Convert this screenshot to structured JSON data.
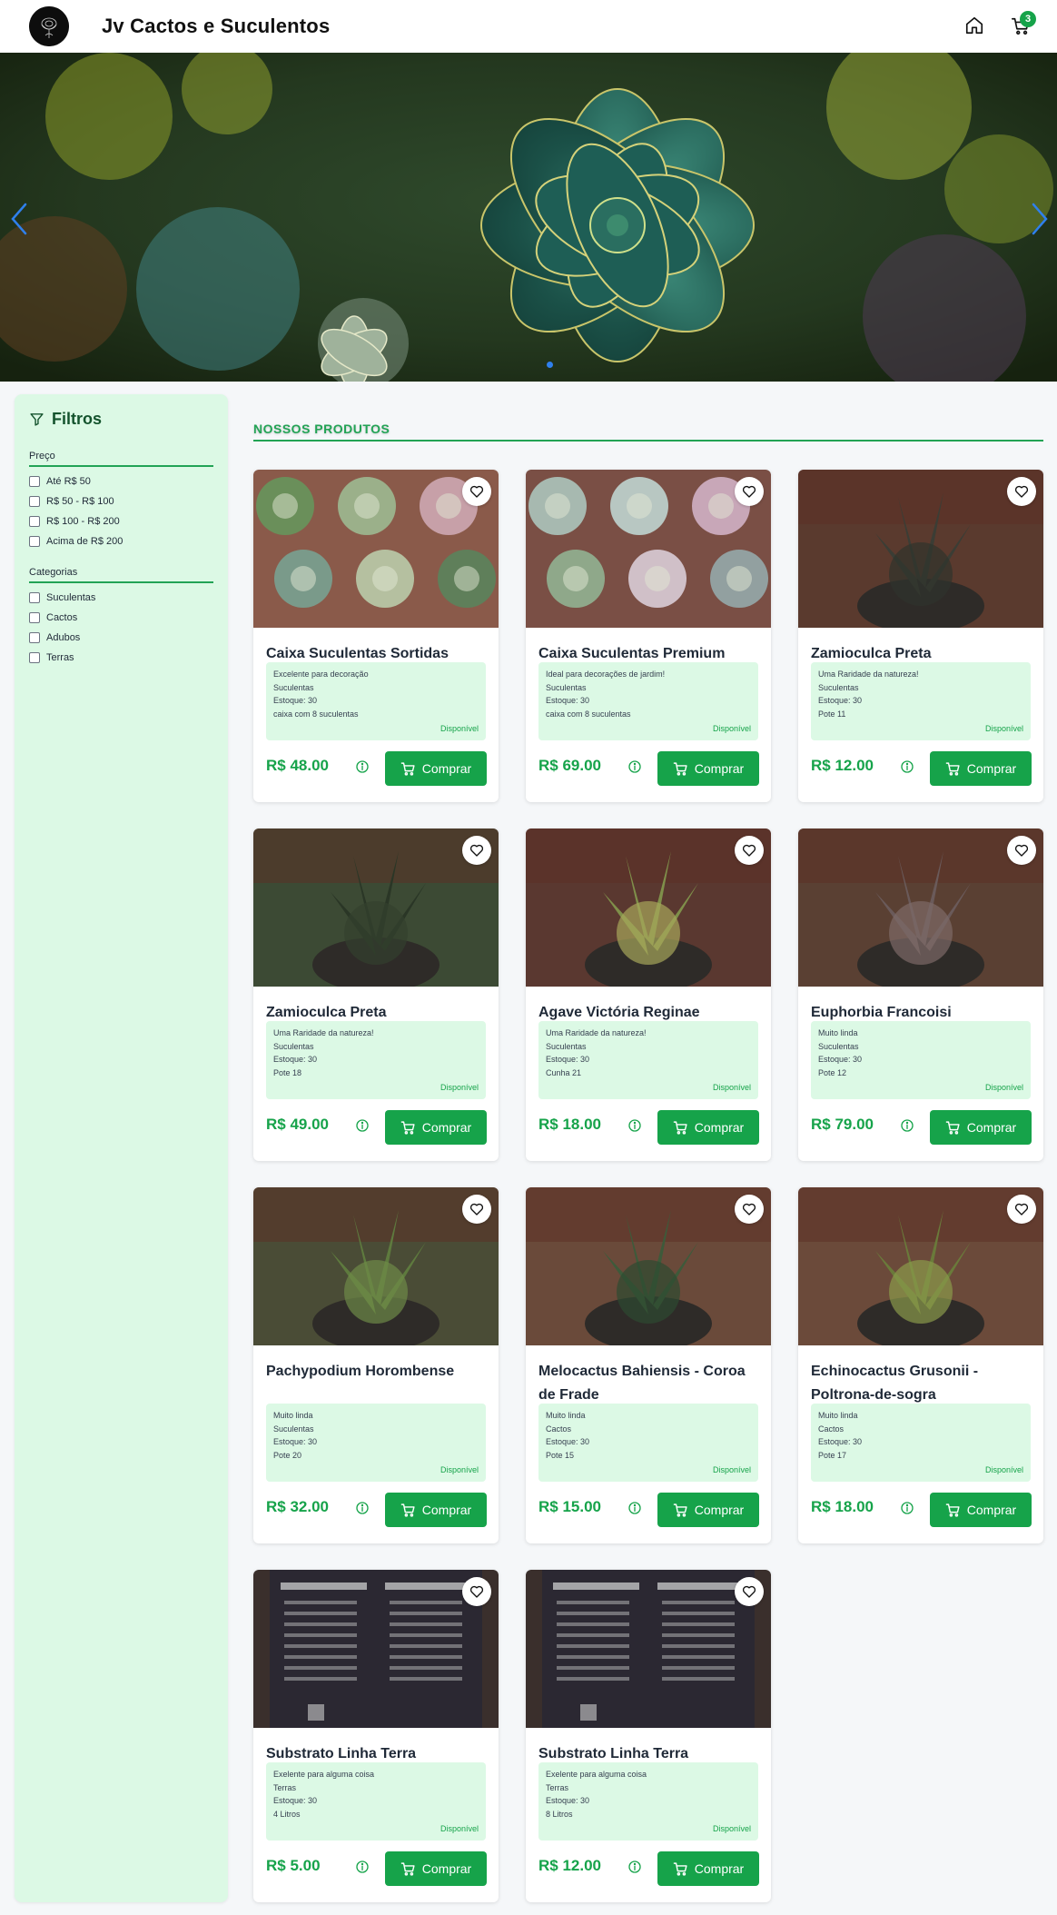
{
  "header": {
    "brand": "Jv Cactos e Suculentos",
    "cart_count": "3",
    "icons": [
      "logo",
      "home-icon",
      "cart-icon"
    ]
  },
  "hero": {
    "prev_icon": "chevron-left-icon",
    "next_icon": "chevron-right-icon",
    "active_slide": 1
  },
  "sidebar": {
    "title": "Filtros",
    "price_title": "Preço",
    "price_options": [
      "Até R$ 50",
      "R$ 50 - R$ 100",
      "R$ 100 - R$ 200",
      "Acima de R$ 200"
    ],
    "category_title": "Categorias",
    "category_options": [
      "Suculentas",
      "Cactos",
      "Adubos",
      "Terras"
    ]
  },
  "main": {
    "section_title": "NOSSOS PRODUTOS",
    "buy_label": "Comprar",
    "products": [
      {
        "name": "Caixa Suculentas Sortidas",
        "desc": "Excelente para decoração",
        "category": "Suculentas",
        "stock": "Estoque: 30",
        "detail": "caixa com 8 suculentas",
        "status": "Disponível",
        "price": "R$ 48.00"
      },
      {
        "name": "Caixa Suculentas Premium",
        "desc": "Ideal para decorações de jardim!",
        "category": "Suculentas",
        "stock": "Estoque: 30",
        "detail": "caixa com 8 suculentas",
        "status": "Disponível",
        "price": "R$ 69.00"
      },
      {
        "name": "Zamioculca Preta",
        "desc": "Uma Raridade da natureza!",
        "category": "Suculentas",
        "stock": "Estoque: 30",
        "detail": "Pote 11",
        "status": "Disponível",
        "price": "R$ 12.00"
      },
      {
        "name": "Zamioculca Preta",
        "desc": "Uma Raridade da natureza!",
        "category": "Suculentas",
        "stock": "Estoque: 30",
        "detail": "Pote 18",
        "status": "Disponível",
        "price": "R$ 49.00"
      },
      {
        "name": "Agave Victória Reginae",
        "desc": "Uma Raridade da natureza!",
        "category": "Suculentas",
        "stock": "Estoque: 30",
        "detail": "Cunha 21",
        "status": "Disponível",
        "price": "R$ 18.00"
      },
      {
        "name": "Euphorbia Francoisi",
        "desc": "Muito linda",
        "category": "Suculentas",
        "stock": "Estoque: 30",
        "detail": "Pote 12",
        "status": "Disponível",
        "price": "R$ 79.00"
      },
      {
        "name": "Pachypodium Horombense",
        "desc": "Muito linda",
        "category": "Suculentas",
        "stock": "Estoque: 30",
        "detail": "Pote 20",
        "status": "Disponível",
        "price": "R$ 32.00"
      },
      {
        "name": "Melocactus Bahiensis - Coroa de Frade",
        "desc": "Muito linda",
        "category": "Cactos",
        "stock": "Estoque: 30",
        "detail": "Pote 15",
        "status": "Disponível",
        "price": "R$ 15.00"
      },
      {
        "name": "Echinocactus Grusonii - Poltrona-de-sogra",
        "desc": "Muito linda",
        "category": "Cactos",
        "stock": "Estoque: 30",
        "detail": "Pote 17",
        "status": "Disponível",
        "price": "R$ 18.00"
      },
      {
        "name": "Substrato Linha Terra",
        "desc": "Exelente para alguma coisa",
        "category": "Terras",
        "stock": "Estoque: 30",
        "detail": "4 Litros",
        "status": "Disponível",
        "price": "R$ 5.00"
      },
      {
        "name": "Substrato Linha Terra",
        "desc": "Exelente para alguma coisa",
        "category": "Terras",
        "stock": "Estoque: 30",
        "detail": "8 Litros",
        "status": "Disponível",
        "price": "R$ 12.00"
      }
    ]
  },
  "colors": {
    "accent": "#16a34a",
    "sidebar_bg": "#dcf9e5",
    "page_bg": "#f5f7f9"
  }
}
